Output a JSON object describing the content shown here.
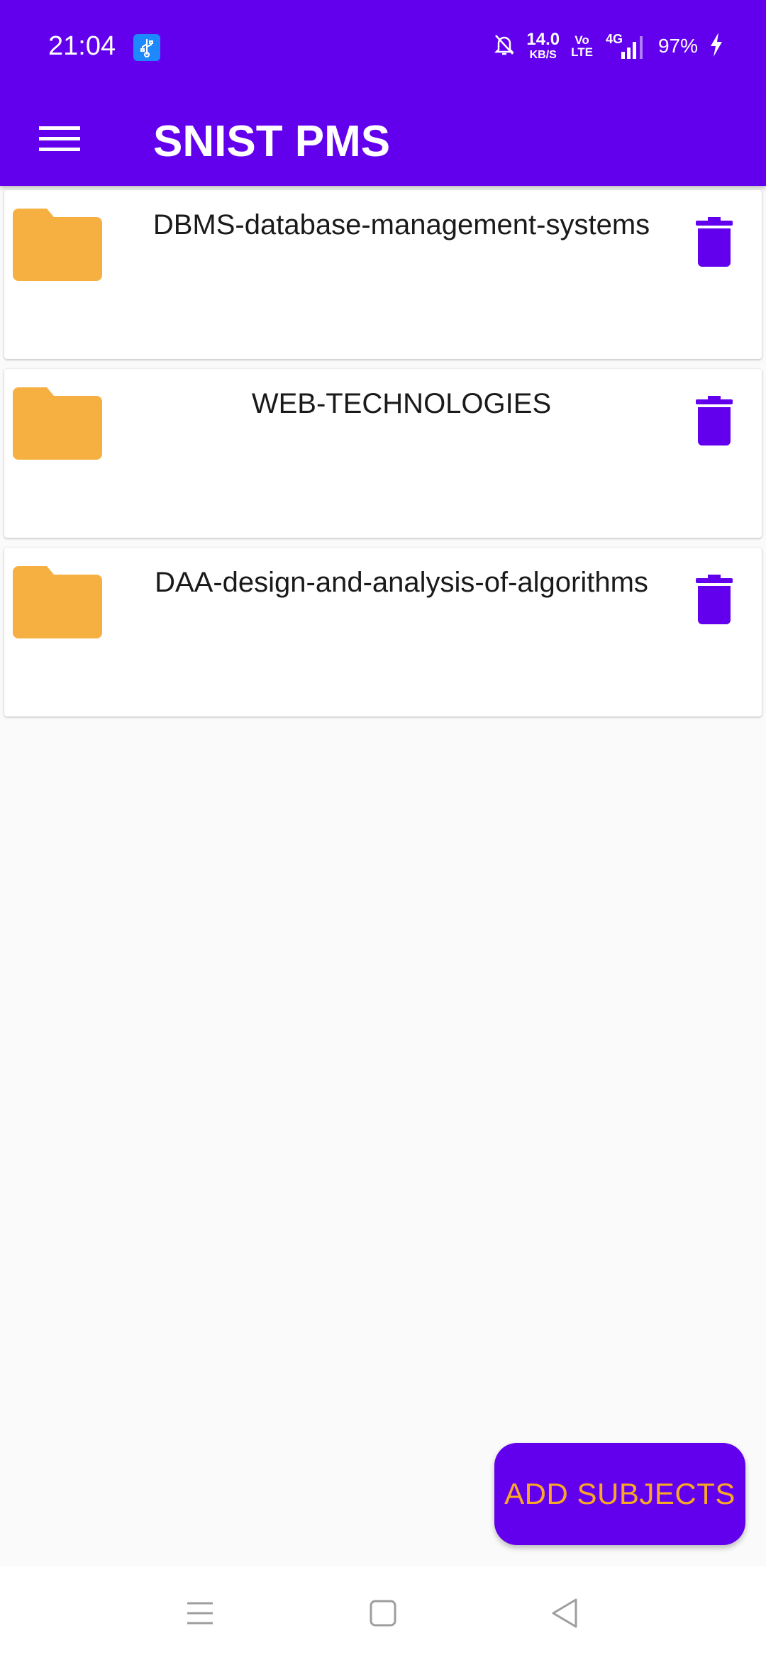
{
  "status_bar": {
    "time": "21:04",
    "net_speed_value": "14.0",
    "net_speed_unit": "KB/S",
    "volte_top": "Vo",
    "volte_bottom": "LTE",
    "network_type": "4G",
    "battery": "97%"
  },
  "app_bar": {
    "title": "SNIST PMS"
  },
  "subjects": [
    {
      "name": "DBMS-database-management-systems"
    },
    {
      "name": "WEB-TECHNOLOGIES"
    },
    {
      "name": "DAA-design-and-analysis-of-algorithms"
    }
  ],
  "fab": {
    "label": "ADD SUBJECTS"
  },
  "colors": {
    "primary": "#6200EE",
    "folder": "#F6B042",
    "accent_text": "#F9A825",
    "background": "#FAFAFA"
  }
}
